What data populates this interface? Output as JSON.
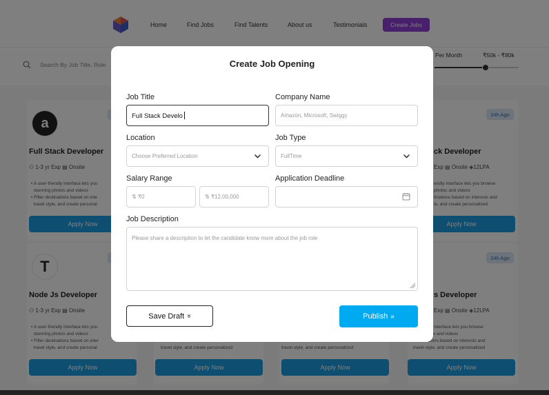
{
  "nav": {
    "items": [
      "Home",
      "Find Jobs",
      "Find Talents",
      "About us",
      "Testimonials"
    ],
    "cta": "Create Jobs"
  },
  "filter": {
    "search_placeholder": "Search By Job Title, Role",
    "per_month": "Per Month",
    "salary_range": "₹50k - ₹80k",
    "slider_level": 0.61
  },
  "cards": [
    {
      "title": "Full Stack Developer",
      "exp": "1-3 yr Exp",
      "mode": "Onsite",
      "salary": "",
      "logo": "amazon-icon",
      "desc1": "A user-friendly interface lets you",
      "desc2": "stunning photos and videos",
      "desc3": "Filter destinations based on inte",
      "desc4": "travel style, and create personal",
      "apply": "Apply Now",
      "badge": ""
    },
    {
      "title": "ck Developer",
      "exp": "Exp",
      "mode": "Onsite",
      "salary": "12LPA",
      "logo": "",
      "desc1": "endly interface lets you browse",
      "desc2": "photos and videos",
      "desc3": "tinations based on interests and",
      "desc4": "le, and create personalized",
      "apply": "Apply Now",
      "badge": "24h Ago"
    },
    {
      "title": "Node Js Developer",
      "exp": "1-3 yr Exp",
      "mode": "Onsite",
      "salary": "",
      "logo": "tesla-icon",
      "desc1": "A user-friendly interface lets you",
      "desc2": "stunning photos and videos",
      "desc3": "Filter destinations based on inter",
      "desc4": "travel style, and create personal",
      "apply": "Apply Now",
      "badge": ""
    },
    {
      "title": "s Developer",
      "exp": "Exp",
      "mode": "Onsite",
      "salary": "12LPA",
      "logo": "",
      "desc1": "endly interface lets you browse",
      "desc2": "photos and videos",
      "desc3": "tinations based on interests and",
      "desc4": "travel style, and create personalized",
      "apply": "Apply Now",
      "badge": "24h Ago"
    }
  ],
  "middle_cards": {
    "desc_a": "travel style, and create personalized",
    "desc_b": "travel style, and create personalized",
    "apply": "Apply Now"
  },
  "modal": {
    "title": "Create Job Opening",
    "job_title_label": "Job Title",
    "job_title_value": "Full Stack Develo",
    "company_label": "Company Name",
    "company_placeholder": "Amazon, Microsoft, Swiggy",
    "location_label": "Location",
    "location_placeholder": "Choose Preferred Location",
    "job_type_label": "Job Type",
    "job_type_value": "FullTime",
    "salary_label": "Salary Range",
    "salary_min_placeholder": "₹0",
    "salary_max_placeholder": "₹12,00,000",
    "deadline_label": "Application Deadline",
    "description_label": "Job Description",
    "description_placeholder": "Please share a description to let the candidate know more about the job role",
    "save_draft": "Save Draft",
    "publish": "Publish"
  },
  "colors": {
    "accent": "#8e3fd6",
    "publish": "#00aaf0",
    "apply": "#1d9de3"
  }
}
